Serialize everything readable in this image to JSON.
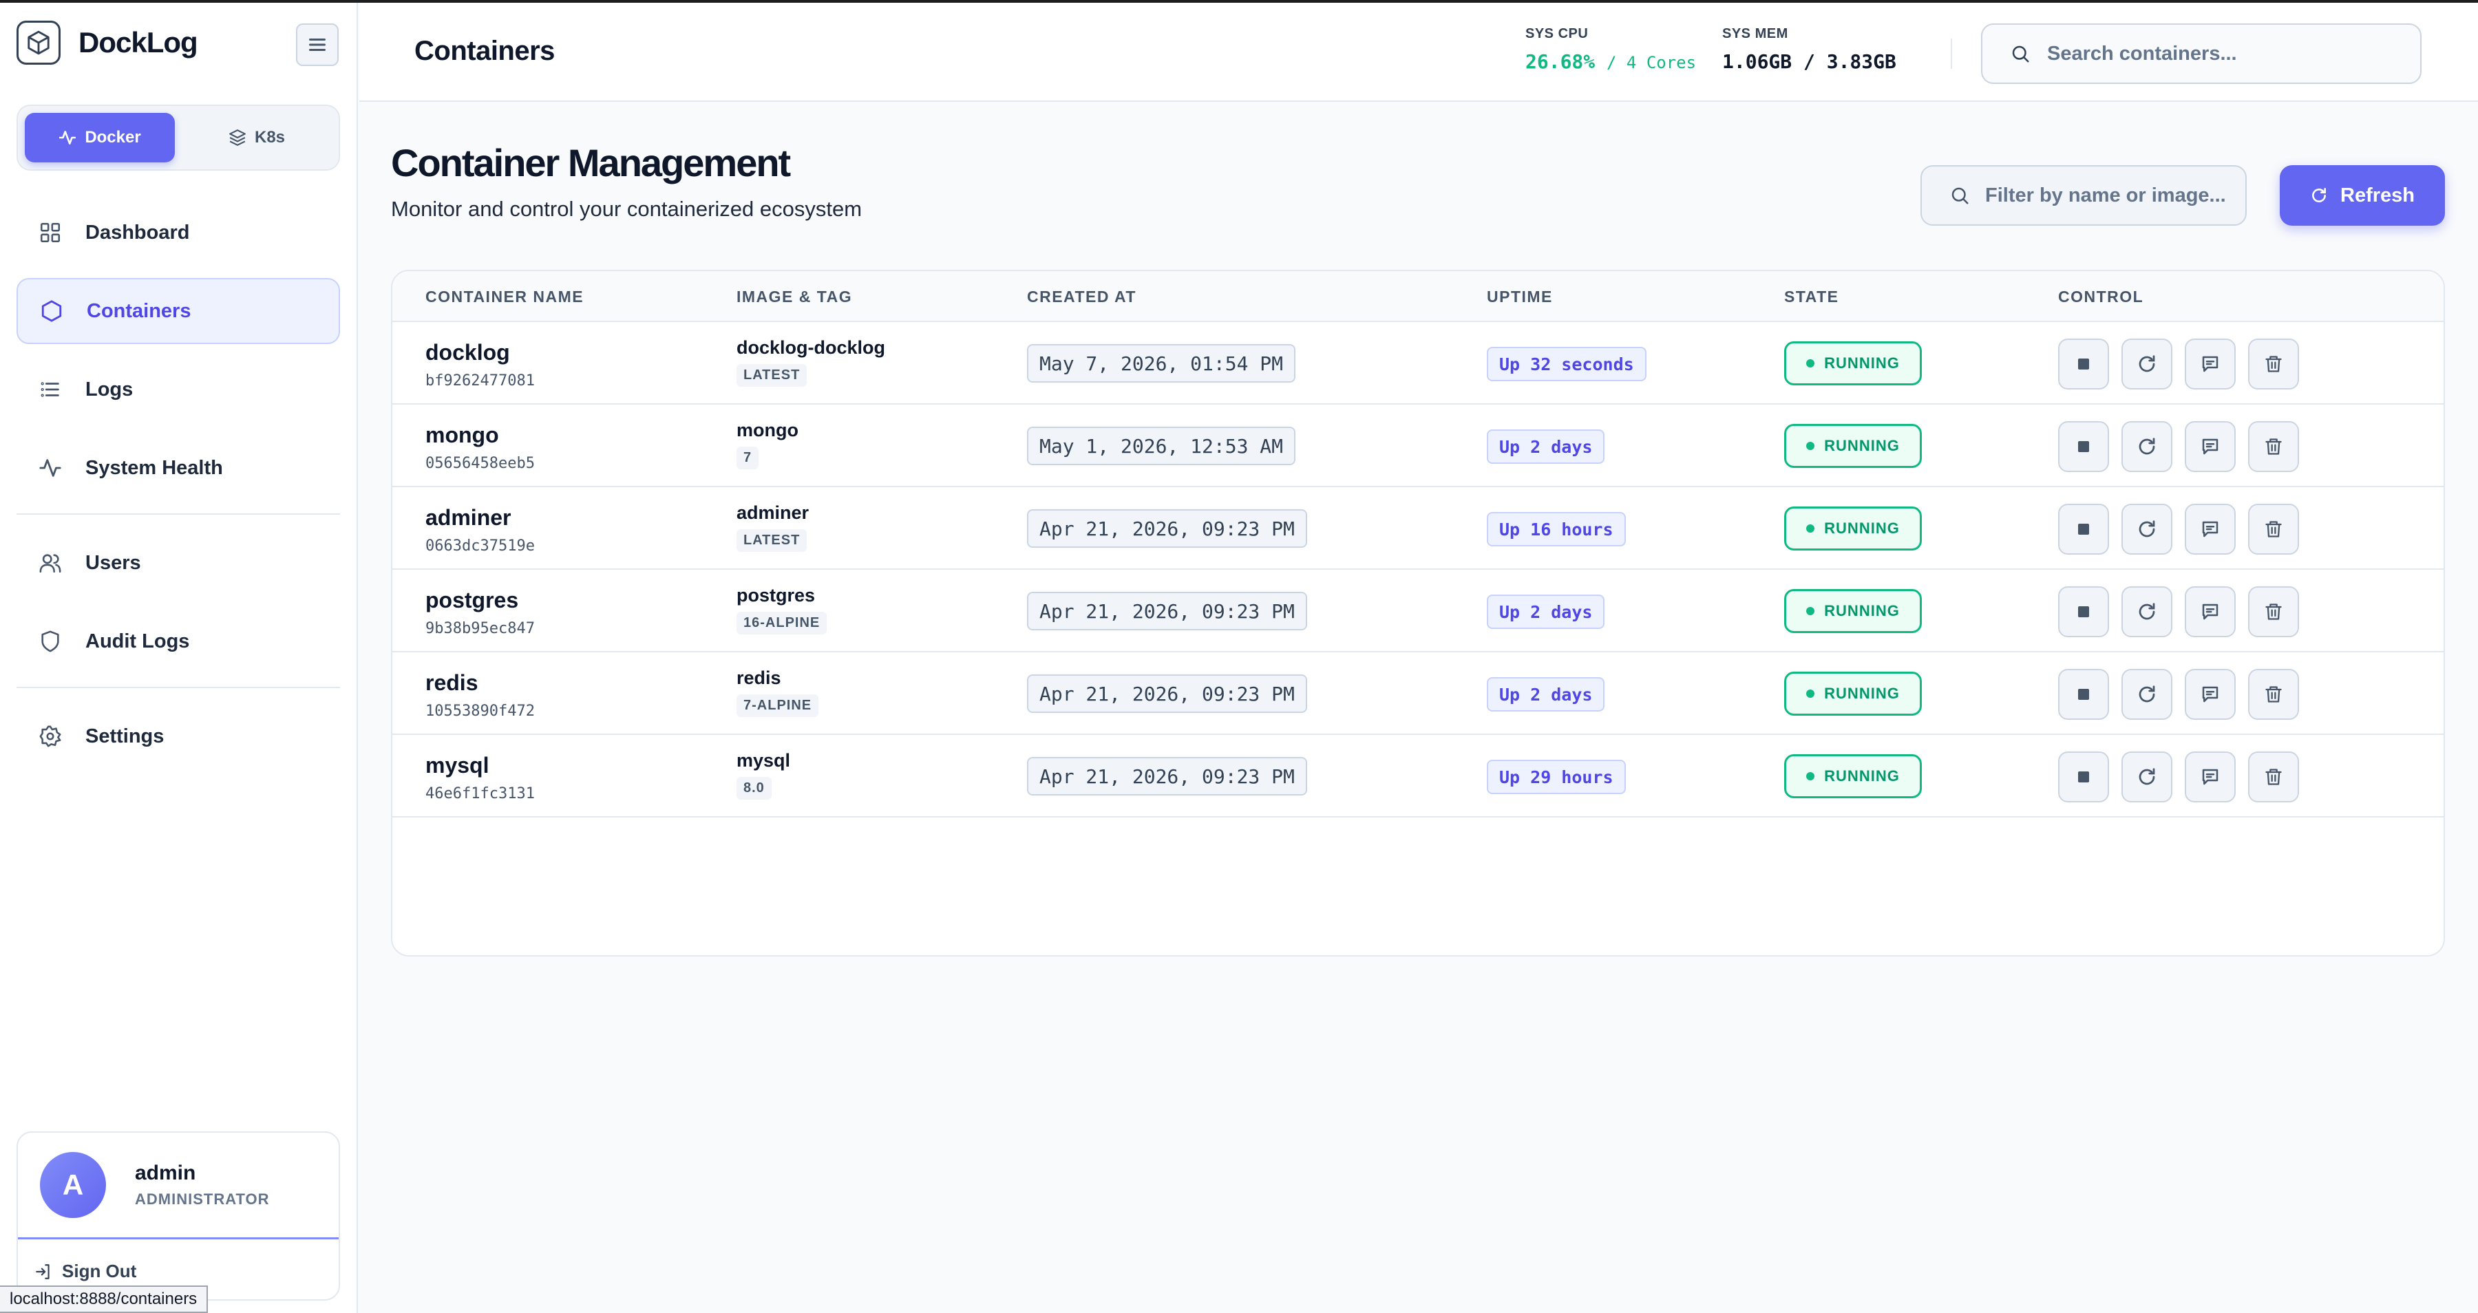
{
  "app": {
    "name": "DockLog",
    "status_url": "localhost:8888/containers"
  },
  "sidebar": {
    "modes": [
      {
        "label": "Docker",
        "active": true
      },
      {
        "label": "K8s",
        "active": false
      }
    ],
    "nav": [
      {
        "label": "Dashboard",
        "icon": "grid-icon",
        "active": false
      },
      {
        "label": "Containers",
        "icon": "hexagon-icon",
        "active": true
      },
      {
        "label": "Logs",
        "icon": "list-icon",
        "active": false
      },
      {
        "label": "System Health",
        "icon": "activity-icon",
        "active": false
      },
      {
        "label": "Users",
        "icon": "users-icon",
        "active": false
      },
      {
        "label": "Audit Logs",
        "icon": "shield-icon",
        "active": false
      },
      {
        "label": "Settings",
        "icon": "gear-icon",
        "active": false
      }
    ],
    "user": {
      "initial": "A",
      "name": "admin",
      "role": "ADMINISTRATOR",
      "signout_label": "Sign Out"
    }
  },
  "topbar": {
    "title": "Containers",
    "cpu": {
      "label": "SYS CPU",
      "value": "26.68%",
      "detail": "/ 4 Cores"
    },
    "mem": {
      "label": "SYS MEM",
      "value": "1.06GB / 3.83GB"
    },
    "search_placeholder": "Search containers..."
  },
  "main": {
    "title": "Container Management",
    "subtitle": "Monitor and control your containerized ecosystem",
    "filter_placeholder": "Filter by name or image...",
    "refresh_label": "Refresh"
  },
  "table": {
    "headers": [
      "CONTAINER NAME",
      "IMAGE & TAG",
      "CREATED AT",
      "UPTIME",
      "STATE",
      "CONTROL"
    ],
    "rows": [
      {
        "name": "docklog",
        "id": "bf9262477081",
        "image": "docklog-docklog",
        "tag": "LATEST",
        "created": "May 7, 2026, 01:54 PM",
        "uptime": "Up 32 seconds",
        "state": "RUNNING"
      },
      {
        "name": "mongo",
        "id": "05656458eeb5",
        "image": "mongo",
        "tag": "7",
        "created": "May 1, 2026, 12:53 AM",
        "uptime": "Up 2 days",
        "state": "RUNNING"
      },
      {
        "name": "adminer",
        "id": "0663dc37519e",
        "image": "adminer",
        "tag": "LATEST",
        "created": "Apr 21, 2026, 09:23 PM",
        "uptime": "Up 16 hours",
        "state": "RUNNING"
      },
      {
        "name": "postgres",
        "id": "9b38b95ec847",
        "image": "postgres",
        "tag": "16-ALPINE",
        "created": "Apr 21, 2026, 09:23 PM",
        "uptime": "Up 2 days",
        "state": "RUNNING"
      },
      {
        "name": "redis",
        "id": "10553890f472",
        "image": "redis",
        "tag": "7-ALPINE",
        "created": "Apr 21, 2026, 09:23 PM",
        "uptime": "Up 2 days",
        "state": "RUNNING"
      },
      {
        "name": "mysql",
        "id": "46e6f1fc3131",
        "image": "mysql",
        "tag": "8.0",
        "created": "Apr 21, 2026, 09:23 PM",
        "uptime": "Up 29 hours",
        "state": "RUNNING"
      }
    ]
  },
  "colors": {
    "accent": "#6366f1",
    "running": "#10b981",
    "text": "#0f172a"
  }
}
